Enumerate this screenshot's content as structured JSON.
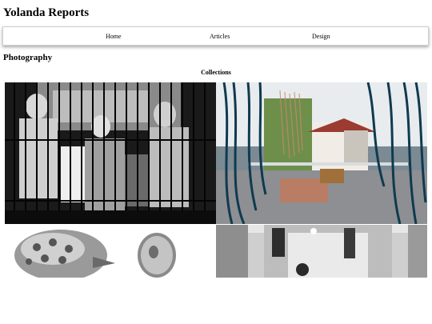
{
  "site": {
    "title": "Yolanda Reports"
  },
  "nav": {
    "items": [
      "Home",
      "Articles",
      "Design"
    ]
  },
  "section": {
    "title": "Photography",
    "subtitle": "Collections"
  },
  "gallery": {
    "photos": [
      {
        "subject": "bw-figures-behind-bars"
      },
      {
        "subject": "rooftop-terrace-hanging-cords"
      },
      {
        "subject": "patterned-hat-and-mirror"
      },
      {
        "subject": "white-gallery-interior"
      }
    ]
  }
}
